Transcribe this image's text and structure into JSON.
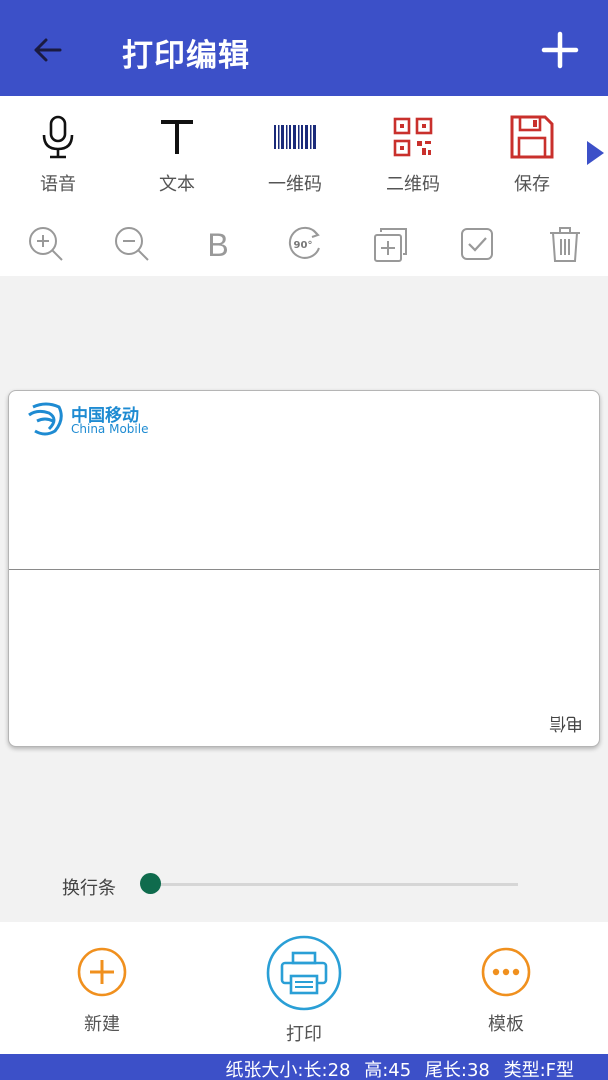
{
  "header": {
    "title": "打印编辑",
    "back_icon": "arrow-left-icon",
    "add_icon": "plus-icon",
    "background": "#3c50c8"
  },
  "toolbar": {
    "items": [
      {
        "label": "语音",
        "icon": "microphone-icon"
      },
      {
        "label": "文本",
        "icon": "text-t-icon"
      },
      {
        "label": "一维码",
        "icon": "barcode-icon"
      },
      {
        "label": "二维码",
        "icon": "qrcode-icon"
      },
      {
        "label": "保存",
        "icon": "save-icon"
      }
    ],
    "more_icon": "triangle-right-icon"
  },
  "edit_tools": [
    "zoom-in-icon",
    "zoom-out-icon",
    "bold-icon",
    "rotate-90-icon",
    "copy-add-icon",
    "checkbox-icon",
    "trash-icon"
  ],
  "edit_labels": {
    "bold": "B",
    "rotate": "90°"
  },
  "label": {
    "logo_cn": "中国移动",
    "logo_en": "China Mobile",
    "flipped_text": "电信"
  },
  "slider": {
    "label": "换行条",
    "value": 0
  },
  "bottom": {
    "new_label": "新建",
    "print_label": "打印",
    "template_label": "模板",
    "accent": "#f0901e",
    "print_color": "#2a9fd6"
  },
  "status": {
    "text": "纸张大小:长:28 高:45 尾长:38 类型:F型"
  }
}
